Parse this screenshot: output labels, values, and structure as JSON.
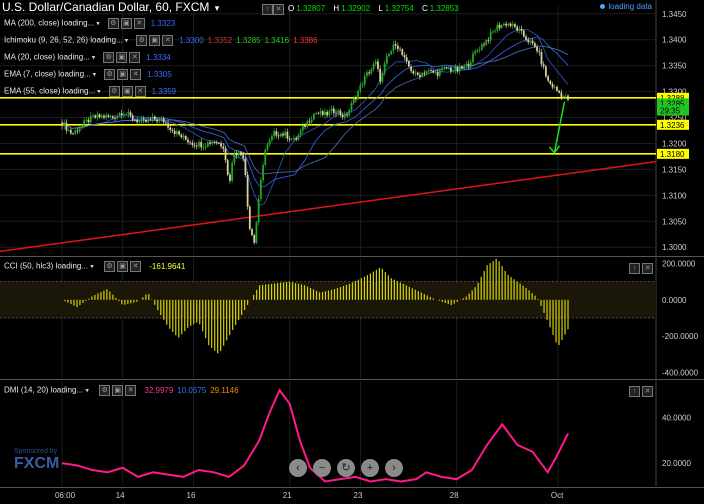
{
  "title": "U.S. Dollar/Canadian Dollar, 60, FXCM",
  "ohlc": {
    "o": "1.32807",
    "h": "1.32902",
    "l": "1.32754",
    "c": "1.32853"
  },
  "status": "loading data",
  "indicators": [
    {
      "label": "MA (200, close) loading...",
      "values": [
        "1.3323"
      ],
      "colors": [
        "#3a6cff"
      ]
    },
    {
      "label": "Ichimoku (9, 26, 52, 26) loading...",
      "values": [
        "1.3300",
        "1.3352",
        "1.3285",
        "1.3416",
        "1.3386"
      ],
      "colors": [
        "#3a6cff",
        "#cc3333",
        "#22cc22",
        "#22cc22",
        "#ff3333"
      ]
    },
    {
      "label": "MA (20, close) loading...",
      "values": [
        "1.3334"
      ],
      "colors": [
        "#3a6cff"
      ]
    },
    {
      "label": "EMA (7, close) loading...",
      "values": [
        "1.3305"
      ],
      "colors": [
        "#3a6cff"
      ]
    },
    {
      "label": "EMA (55, close) loading...",
      "values": [
        "1.3359"
      ],
      "colors": [
        "#3a6cff"
      ]
    }
  ],
  "cci": {
    "label": "CCI (50, hlc3) loading...",
    "value": "-161.9641"
  },
  "dmi": {
    "label": "DMI (14, 20) loading...",
    "values": [
      "32.9979",
      "10.0575",
      "29.1146"
    ],
    "colors": [
      "#ff3399",
      "#3a6cff",
      "#ff8800"
    ]
  },
  "main_axis": [
    "1.3450",
    "1.3400",
    "1.3350",
    "1.3300",
    "1.3250",
    "1.3200",
    "1.3150",
    "1.3100",
    "1.3050",
    "1.3000"
  ],
  "price_tags": [
    {
      "text": "1.3288",
      "bg": "#ffff00"
    },
    {
      "text": "1.3285",
      "bg": "#22c422"
    },
    {
      "text": "29:35",
      "bg": "#22c422"
    },
    {
      "text": "1.3236",
      "bg": "#ffff00"
    },
    {
      "text": "1.3180",
      "bg": "#ffff00"
    }
  ],
  "cci_axis": [
    "200.0000",
    "0.0000",
    "-200.0000",
    "-400.0000"
  ],
  "dmi_axis": [
    "40.0000",
    "20.0000"
  ],
  "x_labels": [
    "06:00",
    "14",
    "16",
    "21",
    "23",
    "28",
    "Oct"
  ],
  "sponsor": {
    "text": "Sponsored by",
    "logo": "FXCM"
  },
  "nav_icons": [
    "chevron-left-icon",
    "zoom-out-icon",
    "reset-icon",
    "zoom-in-icon",
    "chevron-right-icon"
  ],
  "nav_glyphs": [
    "‹",
    "−",
    "↻",
    "+",
    "›"
  ],
  "header_buttons": [
    "↑",
    "✕"
  ],
  "dropdown_glyph": "▾",
  "chart_data": {
    "type": "candlestick",
    "instrument": "USD/CAD",
    "timeframe": "60",
    "ylim": [
      1.2985,
      1.3465
    ],
    "support_resistance": [
      1.3288,
      1.3236,
      1.318
    ],
    "last_close": 1.32853,
    "trendline": {
      "from": [
        0.0,
        1.299
      ],
      "to": [
        1.0,
        1.3165
      ]
    },
    "projection_arrow": {
      "from": 1.328,
      "to": 1.3182
    },
    "close_path": [
      [
        0.0,
        1.324
      ],
      [
        0.02,
        1.3218
      ],
      [
        0.04,
        1.3236
      ],
      [
        0.06,
        1.325
      ],
      [
        0.08,
        1.3252
      ],
      [
        0.1,
        1.325
      ],
      [
        0.12,
        1.3262
      ],
      [
        0.14,
        1.3248
      ],
      [
        0.16,
        1.324
      ],
      [
        0.18,
        1.3247
      ],
      [
        0.2,
        1.3244
      ],
      [
        0.22,
        1.3225
      ],
      [
        0.24,
        1.321
      ],
      [
        0.26,
        1.32
      ],
      [
        0.28,
        1.3198
      ],
      [
        0.3,
        1.3205
      ],
      [
        0.32,
        1.3195
      ],
      [
        0.33,
        1.312
      ],
      [
        0.34,
        1.3185
      ],
      [
        0.36,
        1.3175
      ],
      [
        0.37,
        1.304
      ],
      [
        0.38,
        1.301
      ],
      [
        0.39,
        1.31
      ],
      [
        0.4,
        1.3185
      ],
      [
        0.42,
        1.322
      ],
      [
        0.44,
        1.3218
      ],
      [
        0.46,
        1.3205
      ],
      [
        0.48,
        1.3235
      ],
      [
        0.5,
        1.326
      ],
      [
        0.52,
        1.3255
      ],
      [
        0.54,
        1.3265
      ],
      [
        0.56,
        1.325
      ],
      [
        0.58,
        1.329
      ],
      [
        0.6,
        1.333
      ],
      [
        0.62,
        1.3355
      ],
      [
        0.63,
        1.332
      ],
      [
        0.64,
        1.336
      ],
      [
        0.66,
        1.3395
      ],
      [
        0.68,
        1.3355
      ],
      [
        0.7,
        1.333
      ],
      [
        0.72,
        1.334
      ],
      [
        0.74,
        1.3335
      ],
      [
        0.76,
        1.3345
      ],
      [
        0.78,
        1.334
      ],
      [
        0.8,
        1.335
      ],
      [
        0.82,
        1.338
      ],
      [
        0.84,
        1.34
      ],
      [
        0.86,
        1.3425
      ],
      [
        0.88,
        1.3432
      ],
      [
        0.9,
        1.342
      ],
      [
        0.92,
        1.34
      ],
      [
        0.94,
        1.338
      ],
      [
        0.95,
        1.335
      ],
      [
        0.96,
        1.332
      ],
      [
        0.98,
        1.33
      ],
      [
        1.0,
        1.3285
      ]
    ],
    "cci_series": [
      [
        0.0,
        0
      ],
      [
        0.03,
        -40
      ],
      [
        0.06,
        20
      ],
      [
        0.09,
        60
      ],
      [
        0.12,
        -30
      ],
      [
        0.15,
        -10
      ],
      [
        0.17,
        40
      ],
      [
        0.19,
        -60
      ],
      [
        0.21,
        -150
      ],
      [
        0.23,
        -210
      ],
      [
        0.25,
        -150
      ],
      [
        0.27,
        -120
      ],
      [
        0.29,
        -250
      ],
      [
        0.31,
        -300
      ],
      [
        0.33,
        -200
      ],
      [
        0.36,
        -60
      ],
      [
        0.39,
        80
      ],
      [
        0.42,
        90
      ],
      [
        0.45,
        100
      ],
      [
        0.48,
        80
      ],
      [
        0.51,
        40
      ],
      [
        0.54,
        60
      ],
      [
        0.57,
        90
      ],
      [
        0.6,
        130
      ],
      [
        0.63,
        180
      ],
      [
        0.65,
        120
      ],
      [
        0.68,
        80
      ],
      [
        0.71,
        40
      ],
      [
        0.74,
        0
      ],
      [
        0.77,
        -30
      ],
      [
        0.8,
        20
      ],
      [
        0.82,
        80
      ],
      [
        0.84,
        190
      ],
      [
        0.86,
        230
      ],
      [
        0.88,
        140
      ],
      [
        0.9,
        100
      ],
      [
        0.92,
        60
      ],
      [
        0.94,
        10
      ],
      [
        0.96,
        -120
      ],
      [
        0.98,
        -260
      ],
      [
        1.0,
        -162
      ]
    ],
    "cci_ylim": [
      -430,
      230
    ],
    "dmi_series": [
      [
        0.0,
        20
      ],
      [
        0.03,
        19
      ],
      [
        0.06,
        17
      ],
      [
        0.09,
        16
      ],
      [
        0.12,
        18
      ],
      [
        0.15,
        14
      ],
      [
        0.18,
        16
      ],
      [
        0.21,
        15
      ],
      [
        0.24,
        14
      ],
      [
        0.27,
        17
      ],
      [
        0.3,
        16
      ],
      [
        0.33,
        14
      ],
      [
        0.36,
        19
      ],
      [
        0.39,
        30
      ],
      [
        0.41,
        42
      ],
      [
        0.43,
        52
      ],
      [
        0.45,
        46
      ],
      [
        0.47,
        30
      ],
      [
        0.49,
        18
      ],
      [
        0.52,
        12
      ],
      [
        0.55,
        13
      ],
      [
        0.58,
        14
      ],
      [
        0.61,
        12
      ],
      [
        0.64,
        13
      ],
      [
        0.67,
        12
      ],
      [
        0.7,
        13
      ],
      [
        0.72,
        16
      ],
      [
        0.75,
        14
      ],
      [
        0.78,
        13
      ],
      [
        0.81,
        17
      ],
      [
        0.84,
        28
      ],
      [
        0.87,
        37
      ],
      [
        0.9,
        28
      ],
      [
        0.93,
        25
      ],
      [
        0.96,
        16
      ],
      [
        0.98,
        24
      ],
      [
        1.0,
        33
      ]
    ],
    "dmi_ylim": [
      10,
      56
    ]
  }
}
